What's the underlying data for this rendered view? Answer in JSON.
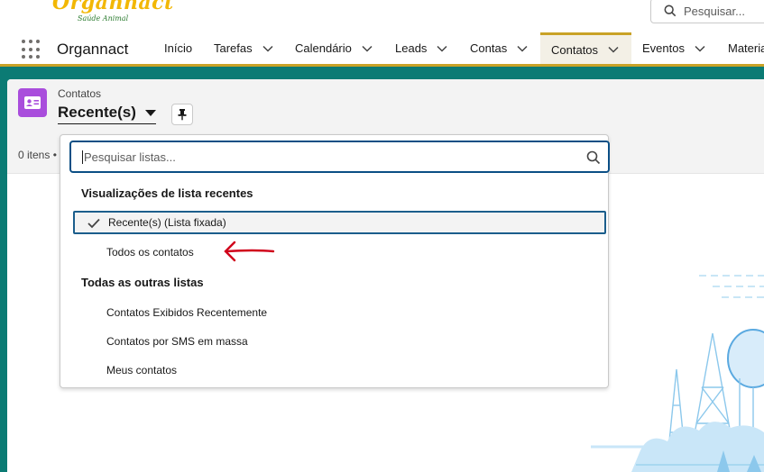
{
  "header": {
    "logo_text": "Organnact",
    "logo_tagline": "Saúde Animal",
    "search_placeholder": "Pesquisar..."
  },
  "nav": {
    "app_name": "Organnact",
    "items": [
      {
        "label": "Início",
        "has_menu": false
      },
      {
        "label": "Tarefas",
        "has_menu": true
      },
      {
        "label": "Calendário",
        "has_menu": true
      },
      {
        "label": "Leads",
        "has_menu": true
      },
      {
        "label": "Contas",
        "has_menu": true
      },
      {
        "label": "Contatos",
        "has_menu": true,
        "active": true
      },
      {
        "label": "Eventos",
        "has_menu": true
      },
      {
        "label": "Materia",
        "has_menu": false
      }
    ]
  },
  "list_view": {
    "object_label": "Contatos",
    "current_list": "Recente(s)",
    "items_count": "0 itens •"
  },
  "dropdown": {
    "search_placeholder": "Pesquisar listas...",
    "sections": [
      {
        "heading": "Visualizações de lista recentes",
        "options": [
          {
            "label": "Recente(s) (Lista fixada)",
            "selected": true
          },
          {
            "label": "Todos os contatos",
            "selected": false
          }
        ]
      },
      {
        "heading": "Todas as outras listas",
        "options": [
          {
            "label": "Contatos Exibidos Recentemente",
            "selected": false
          },
          {
            "label": "Contatos por SMS em massa",
            "selected": false
          },
          {
            "label": "Meus contatos",
            "selected": false
          }
        ]
      }
    ]
  },
  "colors": {
    "brand_teal": "#0b7b74",
    "nav_accent": "#c9a227",
    "object_icon": "#a94ddc",
    "focus_blue": "#0b4f85",
    "annotation_red": "#d0021b"
  }
}
